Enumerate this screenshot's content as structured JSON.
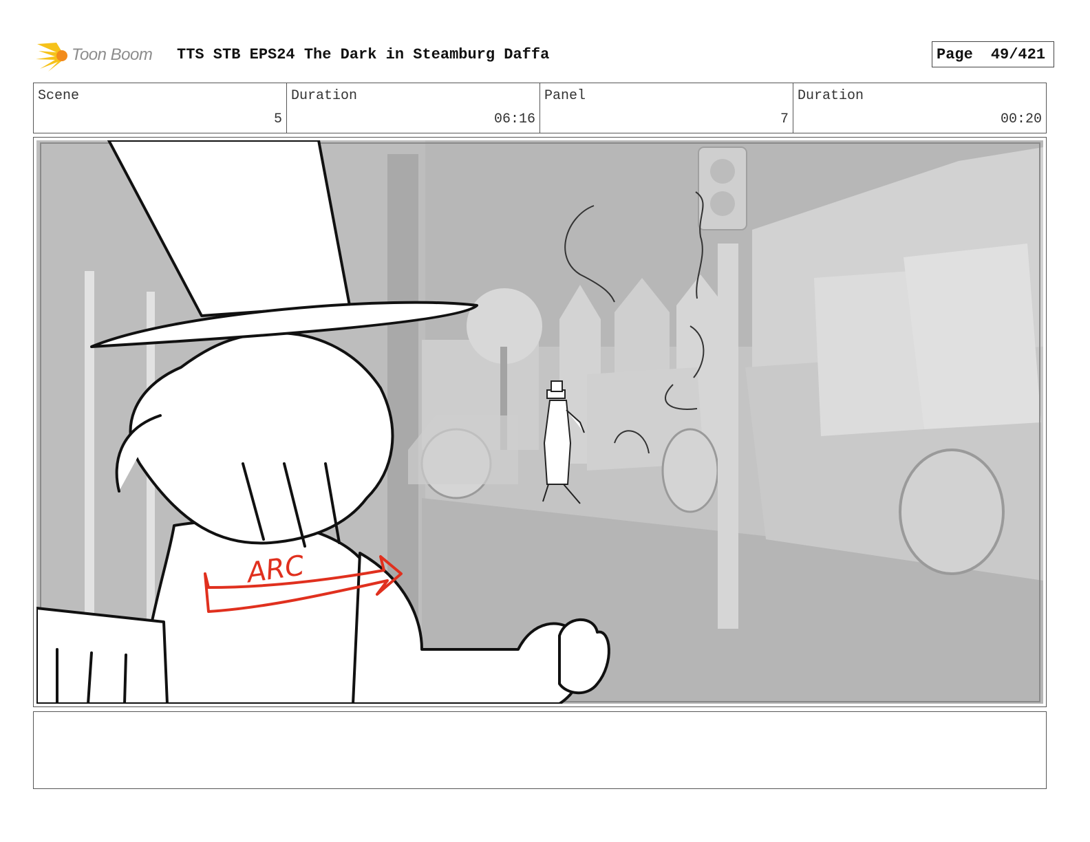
{
  "header": {
    "logo_text": "Toon Boom",
    "title": "TTS STB EPS24 The Dark in Steamburg Daffa",
    "page_label": "Page",
    "page_value": "49/421"
  },
  "info": [
    {
      "label": "Scene",
      "value": "5"
    },
    {
      "label": "Duration",
      "value": "06:16"
    },
    {
      "label": "Panel",
      "value": "7"
    },
    {
      "label": "Duration",
      "value": "00:20"
    }
  ],
  "panel": {
    "annotation": "ARC",
    "annotation_color": "#e0301e"
  },
  "caption": {
    "text": ""
  },
  "colors": {
    "logo_yellow": "#f6c21a",
    "logo_orange": "#f28b1c",
    "background_gray": "#c4c4c4"
  }
}
